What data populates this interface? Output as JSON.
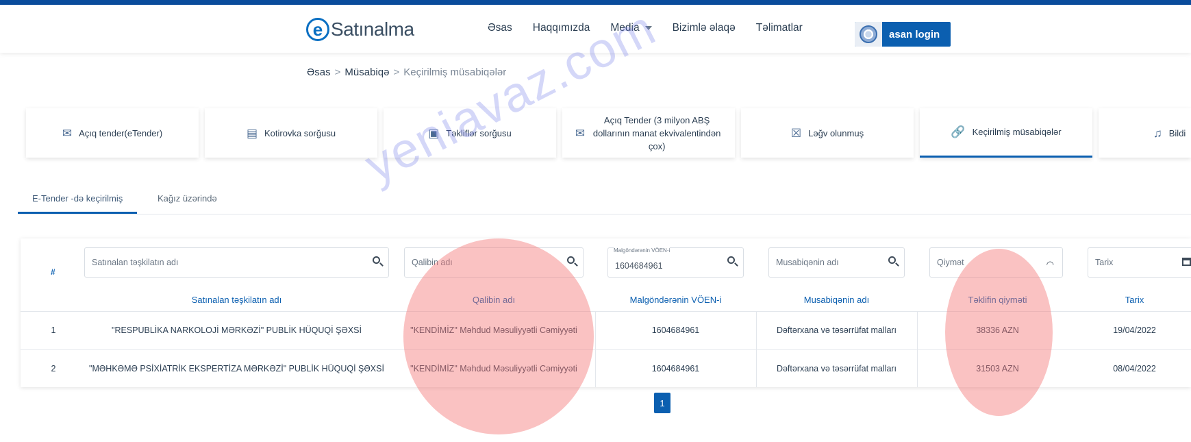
{
  "header": {
    "logo_text": "Satınalma",
    "nav": [
      "Əsas",
      "Haqqımızda",
      "Media",
      "Bizimlə əlaqə",
      "Təlimatlar"
    ],
    "login_label": "asan login"
  },
  "breadcrumb": [
    "Əsas",
    "Müsabiqə",
    "Keçirilmiş müsabiqələr"
  ],
  "category_cards": [
    {
      "label": "Açıq tender(eTender)",
      "icon": "envelope-icon"
    },
    {
      "label": "Kotirovka sorğusu",
      "icon": "message-icon"
    },
    {
      "label": "Təkliflər sorğusu",
      "icon": "chat-icon"
    },
    {
      "label": "Açıq Tender (3 milyon ABŞ dollarının manat ekvivalentindən çox)",
      "icon": "envelope-icon"
    },
    {
      "label": "Ləğv olunmuş",
      "icon": "cancel-icon"
    },
    {
      "label": "Keçirilmiş müsabiqələr",
      "icon": "link-icon",
      "active": true
    },
    {
      "label": "Bildi",
      "icon": "bell-icon"
    }
  ],
  "subtabs": [
    "E-Tender -də keçirilmiş",
    "Kağız üzərində"
  ],
  "filters": {
    "org_placeholder": "Satınalan təşkilatın adı",
    "winner_placeholder": "Qalibin adı",
    "voen_label": "Malgöndərənin VÖEN-i",
    "voen_value": "1604684961",
    "contest_placeholder": "Musabiqənin adı",
    "price_placeholder": "Qiymət",
    "date_placeholder": "Tarix"
  },
  "table": {
    "hash": "#",
    "columns": [
      "Satınalan təşkilatın adı",
      "Qalibin adı",
      "Malgöndərənin VÖEN-i",
      "Musabiqənin adı",
      "Təklifin qiyməti",
      "Tarix"
    ],
    "rows": [
      {
        "num": "1",
        "org": "\"RESPUBLİKA NARKOLOJİ MƏRKƏZİ\" PUBLİK HÜQUQİ ŞƏXSİ",
        "winner": "\"KENDİMİZ\" Məhdud Məsuliyyətli Cəmiyyəti",
        "voen": "1604684961",
        "contest": "Dəftərxana və təsərrüfat malları",
        "price": "38336 AZN",
        "date": "19/04/2022"
      },
      {
        "num": "2",
        "org": "\"MƏHKƏMƏ PSİXİATRİK EKSPERTİZA MƏRKƏZİ\" PUBLİK HÜQUQİ ŞƏXSİ",
        "winner": "\"KENDİMİZ\" Məhdud Məsuliyyətli Cəmiyyəti",
        "voen": "1604684961",
        "contest": "Dəftərxana və təsərrüfat malları",
        "price": "31503 AZN",
        "date": "08/04/2022"
      }
    ]
  },
  "pagination": {
    "current": "1"
  },
  "watermark": "yeniavaz.com",
  "colors": {
    "primary": "#0b5fb0",
    "highlight": "#f47878"
  }
}
